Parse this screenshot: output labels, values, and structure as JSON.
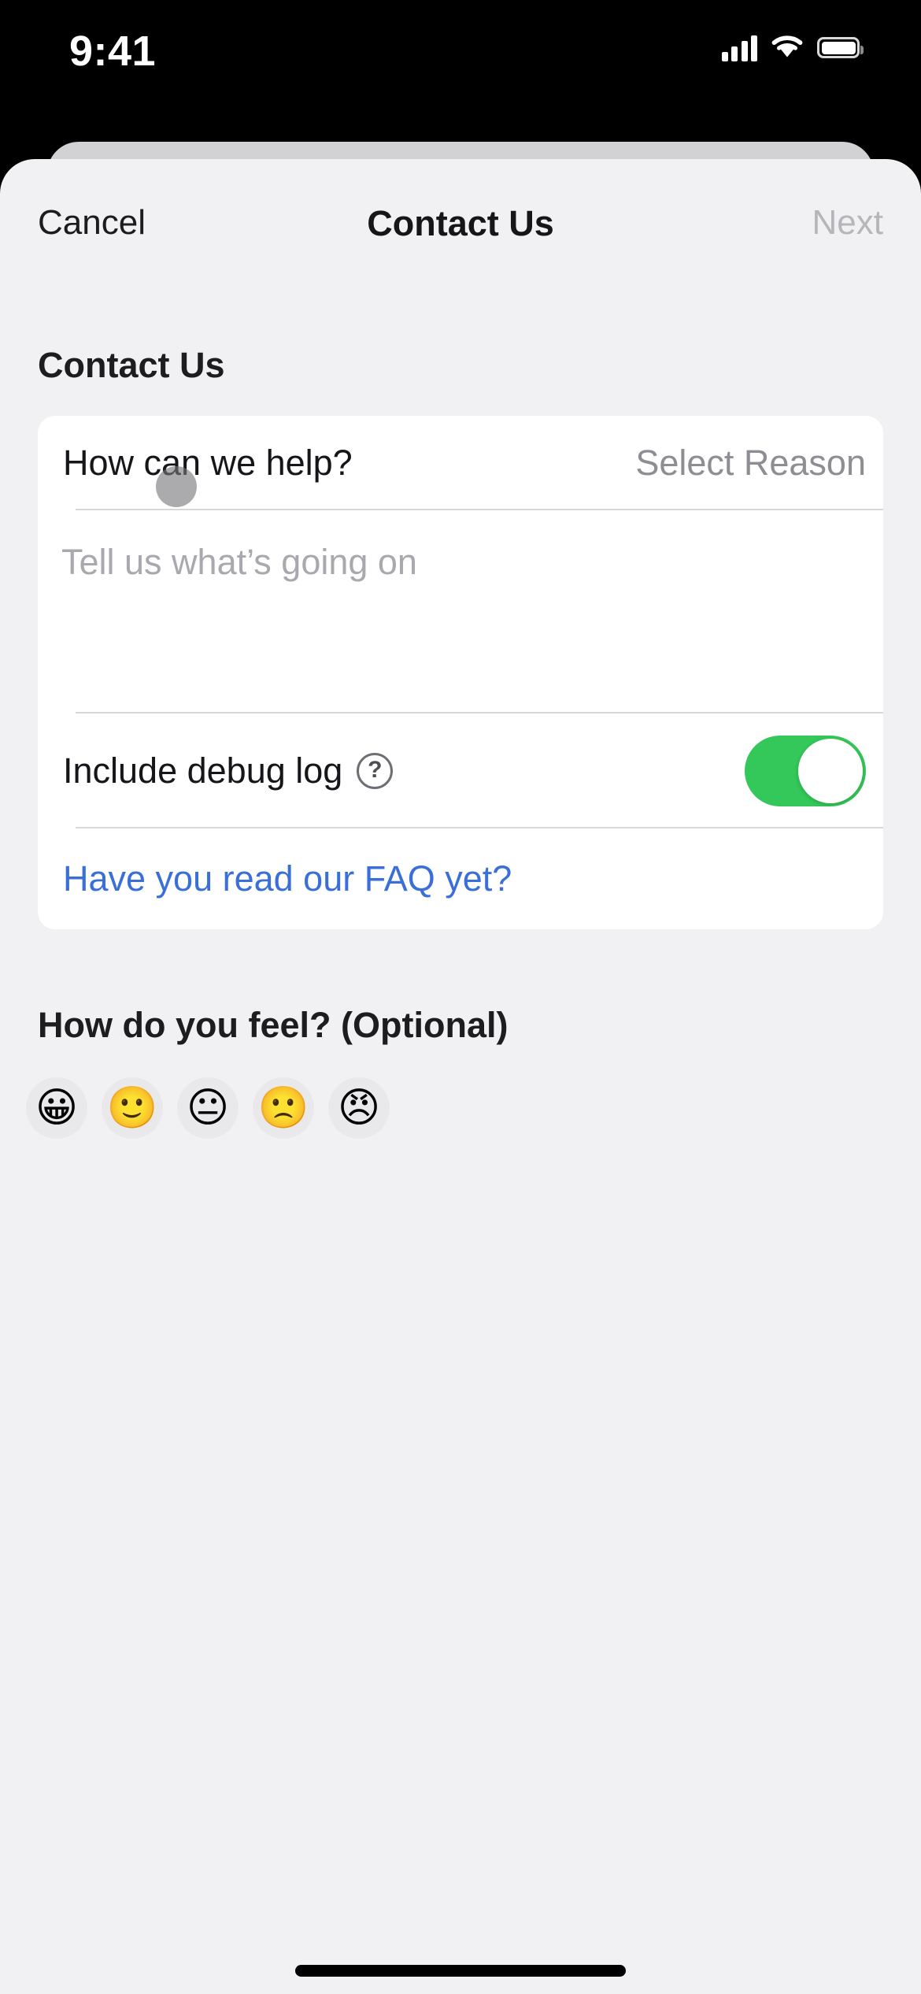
{
  "status_bar": {
    "time": "9:41",
    "cellular_icon": "cellular-signal-icon",
    "wifi_icon": "wifi-icon",
    "battery_icon": "battery-full-icon"
  },
  "nav_bar": {
    "cancel_label": "Cancel",
    "title": "Contact Us",
    "next_label": "Next",
    "next_disabled": true
  },
  "contact_section": {
    "header": "Contact Us",
    "reason_row": {
      "label": "How can we help?",
      "value": "Select Reason"
    },
    "message_row": {
      "value": "",
      "placeholder": "Tell us what’s going on"
    },
    "debug_row": {
      "label": "Include debug log",
      "help_icon": "question-mark-circle-icon",
      "help_glyph": "?",
      "toggle_on": true
    },
    "faq_row": {
      "link_label": "Have you read our FAQ yet?"
    }
  },
  "feel_section": {
    "header": "How do you feel? (Optional)",
    "options": [
      {
        "name": "emoji-grinning",
        "glyph": "😀",
        "label": "Grinning"
      },
      {
        "name": "emoji-smiling",
        "glyph": "🙂",
        "label": "Slightly smiling"
      },
      {
        "name": "emoji-neutral",
        "glyph": "😐",
        "label": "Neutral"
      },
      {
        "name": "emoji-frowning",
        "glyph": "🙁",
        "label": "Slightly frowning"
      },
      {
        "name": "emoji-angry",
        "glyph": "😠",
        "label": "Angry"
      }
    ]
  },
  "overlay": {
    "tap_indicator": "touch-point-indicator"
  },
  "colors": {
    "accent_blue": "#3a6fd8",
    "toggle_green": "#34c759",
    "card_background": "#ffffff",
    "sheet_background": "#f1f0f3",
    "placeholder_gray": "#a9a8ae",
    "disabled_gray": "#b6b5ba",
    "emoji_button_gray": "#e9e8ea"
  }
}
